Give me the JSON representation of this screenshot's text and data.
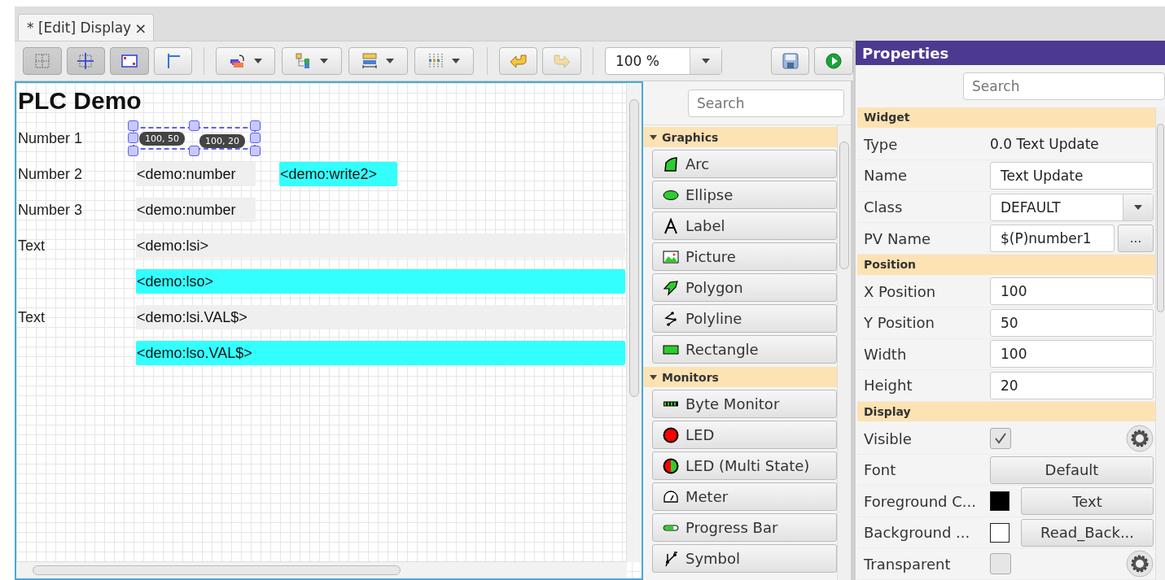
{
  "tab": {
    "title": "* [Edit] Display",
    "close": "×"
  },
  "toolbar": {
    "toggles": [
      {
        "kind": "grid",
        "selected": true
      },
      {
        "kind": "snap",
        "selected": true
      },
      {
        "kind": "coords",
        "selected": true
      },
      {
        "kind": "guides",
        "selected": false
      }
    ],
    "dropdowns": [
      {
        "kind": "order"
      },
      {
        "kind": "align"
      },
      {
        "kind": "size"
      },
      {
        "kind": "distribute"
      }
    ],
    "undo": {
      "disabled": false
    },
    "redo": {
      "disabled": true
    },
    "zoom": "100 %"
  },
  "canvas": {
    "title": "PLC Demo",
    "rows": [
      {
        "label": "Number 1",
        "widgets": [
          {
            "kind": "selection",
            "badges": [
              "100, 50",
              "100, 20"
            ]
          }
        ]
      },
      {
        "label": "Number 2",
        "widgets": [
          {
            "kind": "update",
            "text": "<demo:number"
          },
          {
            "kind": "control",
            "text": "<demo:write2>"
          }
        ]
      },
      {
        "label": "Number 3",
        "widgets": [
          {
            "kind": "update",
            "text": "<demo:number"
          }
        ]
      },
      {
        "label": "Text",
        "widgets": [
          {
            "kind": "update_wide",
            "text": "<demo:lsi>"
          }
        ]
      },
      {
        "widgets": [
          {
            "kind": "control_wide",
            "text": "<demo:lso>"
          }
        ]
      },
      {
        "label": "Text",
        "widgets": [
          {
            "kind": "update_wide",
            "text": "<demo:lsi.VAL$>"
          }
        ]
      },
      {
        "widgets": [
          {
            "kind": "control_wide",
            "text": "<demo:lso.VAL$>"
          }
        ]
      }
    ]
  },
  "palette": {
    "search": {
      "placeholder": "Search"
    },
    "sections": [
      {
        "title": "Graphics",
        "expanded": true,
        "items": [
          {
            "label": "Arc",
            "kind": "arc"
          },
          {
            "label": "Ellipse",
            "kind": "ellipse"
          },
          {
            "label": "Label",
            "kind": "label"
          },
          {
            "label": "Picture",
            "kind": "picture"
          },
          {
            "label": "Polygon",
            "kind": "polygon"
          },
          {
            "label": "Polyline",
            "kind": "polyline"
          },
          {
            "label": "Rectangle",
            "kind": "rectangle"
          }
        ]
      },
      {
        "title": "Monitors",
        "expanded": true,
        "items": [
          {
            "label": "Byte Monitor",
            "kind": "byte"
          },
          {
            "label": "LED",
            "kind": "led"
          },
          {
            "label": "LED (Multi State)",
            "kind": "multiled"
          },
          {
            "label": "Meter",
            "kind": "meter"
          },
          {
            "label": "Progress Bar",
            "kind": "progress"
          },
          {
            "label": "Symbol",
            "kind": "symbol"
          }
        ]
      }
    ]
  },
  "properties": {
    "title": "Properties",
    "search": {
      "placeholder": "Search"
    },
    "sections": [
      {
        "title": "Widget",
        "rows": [
          {
            "kind": "text",
            "label": "Type",
            "value": "0.0 Text Update"
          },
          {
            "kind": "field",
            "label": "Name",
            "value": "Text Update"
          },
          {
            "kind": "combo",
            "label": "Class",
            "value": "DEFAULT"
          },
          {
            "kind": "pv",
            "label": "PV Name",
            "value": "$(P)number1",
            "button": "..."
          }
        ]
      },
      {
        "title": "Position",
        "rows": [
          {
            "kind": "field",
            "label": "X Position",
            "value": "100"
          },
          {
            "kind": "field",
            "label": "Y Position",
            "value": "50"
          },
          {
            "kind": "field",
            "label": "Width",
            "value": "100"
          },
          {
            "kind": "field",
            "label": "Height",
            "value": "20"
          }
        ]
      },
      {
        "title": "Display",
        "rows": [
          {
            "kind": "check",
            "label": "Visible",
            "checked": true,
            "rule": true
          },
          {
            "kind": "button",
            "label": "Font",
            "value": "Default"
          },
          {
            "kind": "color",
            "label": "Foreground C...",
            "color": "#000000",
            "value": "Text"
          },
          {
            "kind": "color",
            "label": "Background ...",
            "color": "#ffffff",
            "value": "Read_Back..."
          },
          {
            "kind": "check",
            "label": "Transparent",
            "checked": false,
            "rule": true
          }
        ]
      }
    ]
  }
}
